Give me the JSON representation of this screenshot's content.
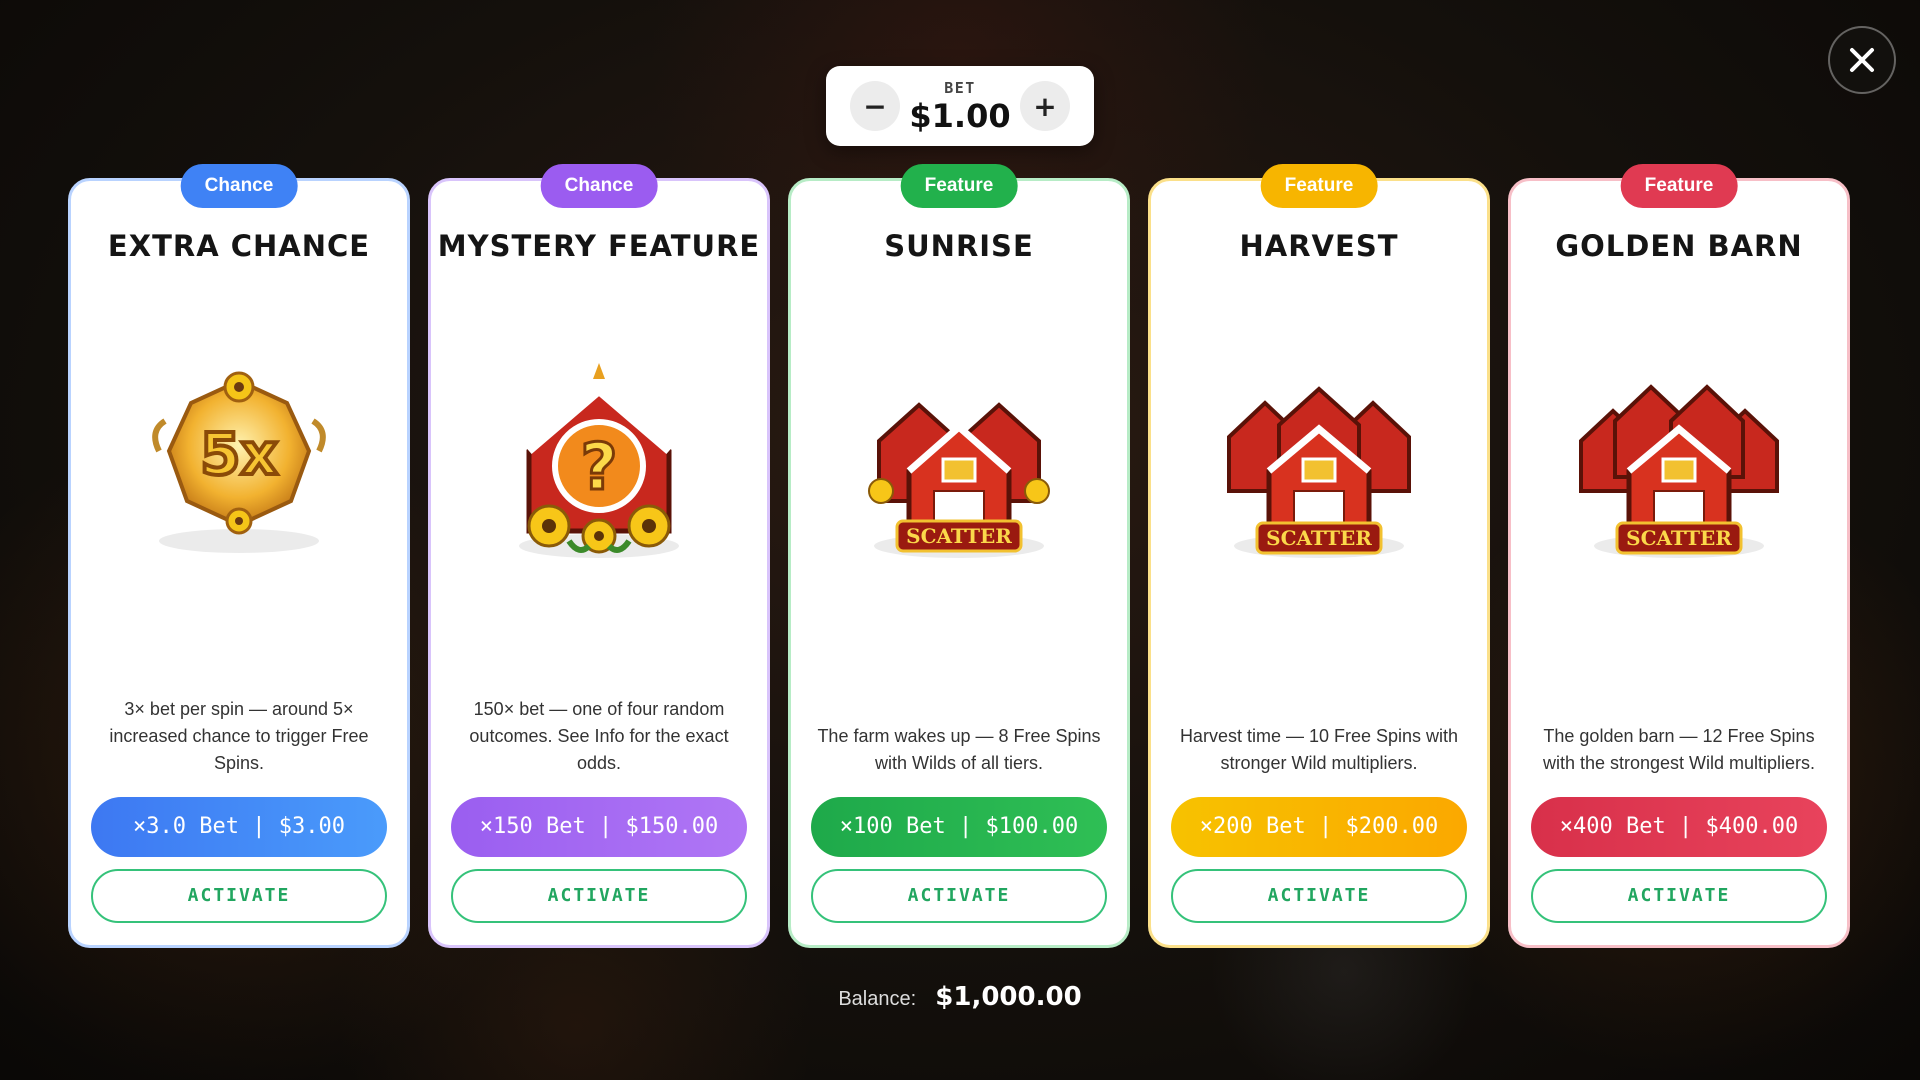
{
  "bet": {
    "label": "BET",
    "value": "$1.00",
    "minus": "−",
    "plus": "+"
  },
  "close": {
    "icon": "close-icon"
  },
  "cards": [
    {
      "badge": "Chance",
      "title": "EXTRA CHANCE",
      "icon": "5x-multiplier-icon",
      "description": "3× bet per spin — around 5× increased chance to trigger Free Spins.",
      "price": "×3.0 Bet | $3.00",
      "action": "ACTIVATE",
      "color": "#3f82f5"
    },
    {
      "badge": "Chance",
      "title": "MYSTERY FEATURE",
      "icon": "mystery-barn-icon",
      "description": "150× bet — one of four random outcomes. See Info for the exact odds.",
      "price": "×150 Bet | $150.00",
      "action": "ACTIVATE",
      "color": "#9b5cf0"
    },
    {
      "badge": "Feature",
      "title": "SUNRISE",
      "icon": "scatter-barns-icon",
      "description": "The farm wakes up — 8 Free Spins with Wilds of all tiers.",
      "price": "×100 Bet | $100.00",
      "action": "ACTIVATE",
      "color": "#22b14c"
    },
    {
      "badge": "Feature",
      "title": "HARVEST",
      "icon": "scatter-barns-icon",
      "description": "Harvest time — 10 Free Spins with stronger Wild multipliers.",
      "price": "×200 Bet | $200.00",
      "action": "ACTIVATE",
      "color": "#f7b500"
    },
    {
      "badge": "Feature",
      "title": "GOLDEN BARN",
      "icon": "scatter-barns-icon",
      "description": "The golden barn — 12 Free Spins with the strongest Wild multipliers.",
      "price": "×400 Bet | $400.00",
      "action": "ACTIVATE",
      "color": "#e03a52"
    }
  ],
  "scatter_label": "SCATTER",
  "balance": {
    "label": "Balance:",
    "value": "$1,000.00"
  }
}
